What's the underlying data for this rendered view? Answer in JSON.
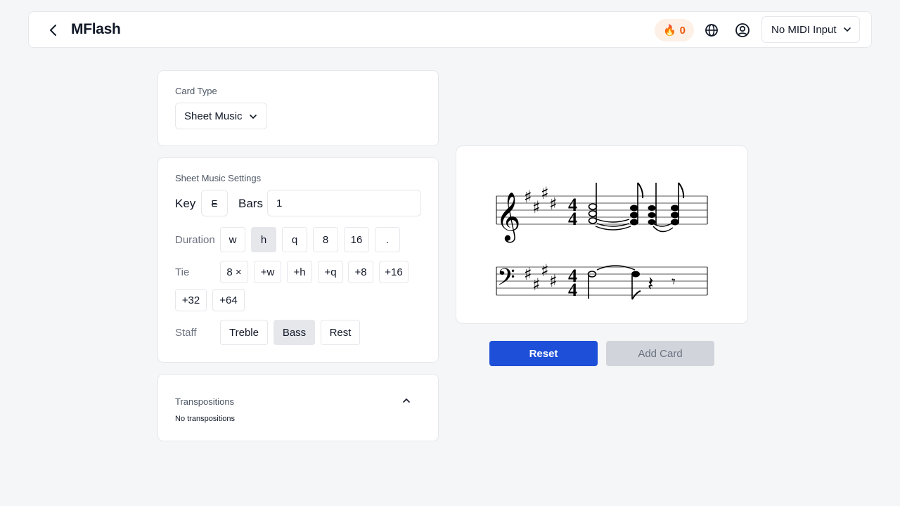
{
  "header": {
    "title": "MFlash",
    "streak_count": "0",
    "midi_input": "No MIDI Input"
  },
  "card_type": {
    "label": "Card Type",
    "value": "Sheet Music"
  },
  "settings": {
    "title": "Sheet Music Settings",
    "key_label": "Key",
    "key_value": "E",
    "bars_label": "Bars",
    "bars_value": "1",
    "duration_label": "Duration",
    "durations": [
      "w",
      "h",
      "q",
      "8",
      "16",
      "."
    ],
    "duration_selected": "h",
    "tie_label": "Tie",
    "ties": [
      "8 ×",
      "+w",
      "+h",
      "+q",
      "+8",
      "+16",
      "+32",
      "+64"
    ],
    "staff_label": "Staff",
    "staffs": [
      "Treble",
      "Bass",
      "Rest"
    ],
    "staff_selected": "Bass"
  },
  "transpositions": {
    "title": "Transpositions",
    "empty_text": "No transpositions"
  },
  "sheet": {
    "clef_treble": "treble",
    "clef_bass": "bass",
    "key_signature": "E major (4 sharps)",
    "time_signature": "4/4"
  },
  "actions": {
    "reset_label": "Reset",
    "add_card_label": "Add Card"
  },
  "colors": {
    "primary": "#1d4fd8",
    "disabled": "#d1d5db",
    "streak": "#ea580c"
  }
}
